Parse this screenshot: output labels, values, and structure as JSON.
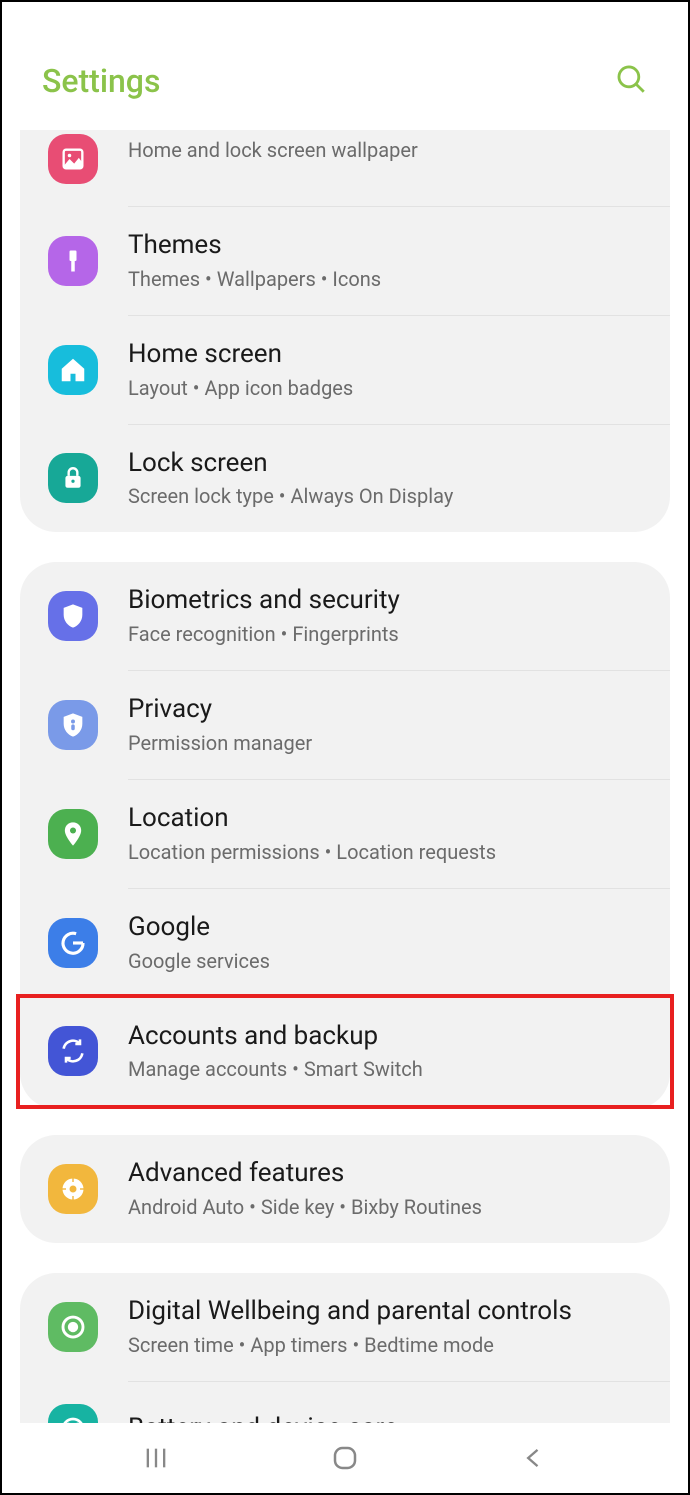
{
  "header": {
    "title": "Settings"
  },
  "groups": [
    {
      "items": [
        {
          "id": "wallpaper",
          "title": "",
          "sub": "Home and lock screen wallpaper",
          "color": "#e84d74",
          "partialTop": true
        },
        {
          "id": "themes",
          "title": "Themes",
          "sub": "Themes  •  Wallpapers  •  Icons",
          "color": "#b566e8"
        },
        {
          "id": "home-screen",
          "title": "Home screen",
          "sub": "Layout  •  App icon badges",
          "color": "#17bddc"
        },
        {
          "id": "lock-screen",
          "title": "Lock screen",
          "sub": "Screen lock type  •  Always On Display",
          "color": "#17a897"
        }
      ]
    },
    {
      "items": [
        {
          "id": "biometrics",
          "title": "Biometrics and security",
          "sub": "Face recognition  •  Fingerprints",
          "color": "#6670e8"
        },
        {
          "id": "privacy",
          "title": "Privacy",
          "sub": "Permission manager",
          "color": "#7a9ae8"
        },
        {
          "id": "location",
          "title": "Location",
          "sub": "Location permissions  •  Location requests",
          "color": "#4cb050"
        },
        {
          "id": "google",
          "title": "Google",
          "sub": "Google services",
          "color": "#3c7ee8"
        },
        {
          "id": "accounts",
          "title": "Accounts and backup",
          "sub": "Manage accounts  •  Smart Switch",
          "color": "#4355d6",
          "highlighted": true
        }
      ]
    },
    {
      "items": [
        {
          "id": "advanced",
          "title": "Advanced features",
          "sub": "Android Auto  •  Side key  •  Bixby Routines",
          "color": "#f2b73d"
        }
      ]
    },
    {
      "items": [
        {
          "id": "wellbeing",
          "title": "Digital Wellbeing and parental controls",
          "sub": "Screen time  •  App timers  •  Bedtime mode",
          "color": "#5fbb63"
        },
        {
          "id": "battery",
          "title": "Battery and device care",
          "sub": "",
          "color": "#17b3a2",
          "partialBottom": true
        }
      ]
    }
  ]
}
